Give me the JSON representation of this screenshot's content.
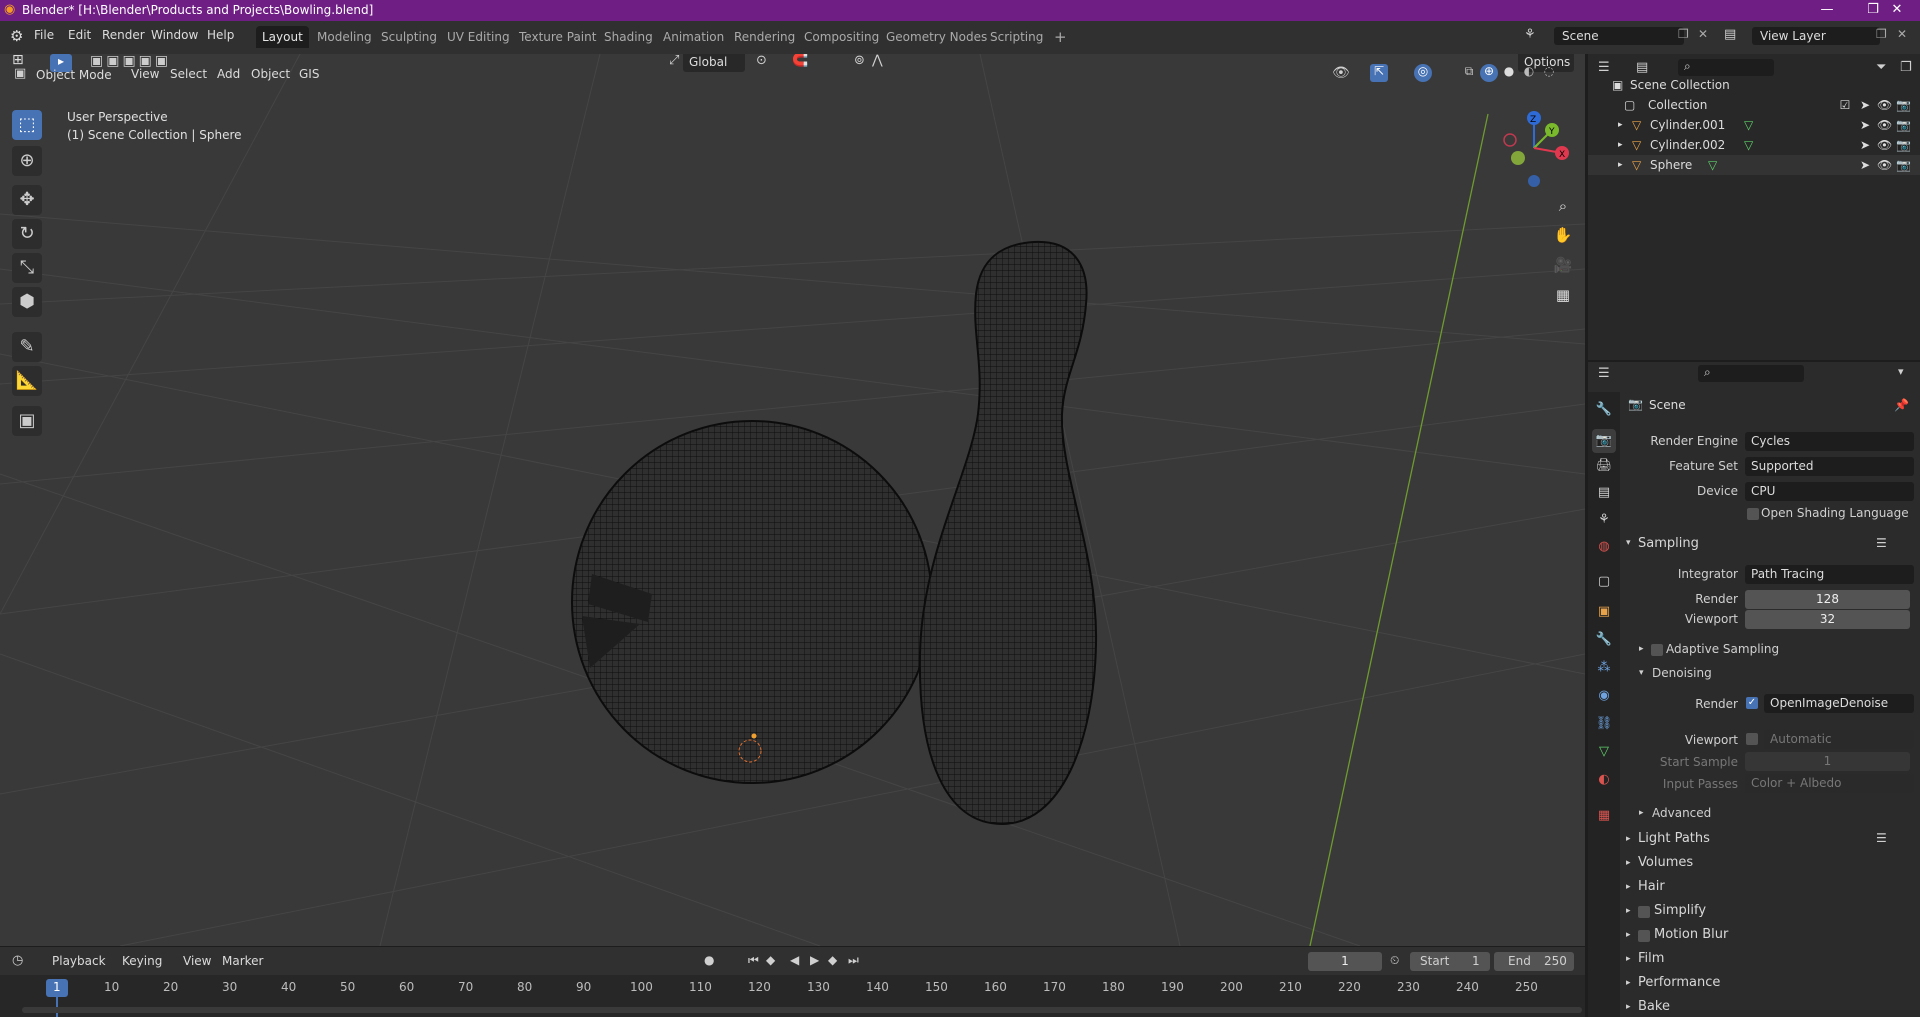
{
  "titlebar": {
    "title": "Blender* [H:\\Blender\\Products and Projects\\Bowling.blend]",
    "minimize": "—",
    "restore": "❐",
    "close": "✕"
  },
  "menu": {
    "file": "File",
    "edit": "Edit",
    "render": "Render",
    "window": "Window",
    "help": "Help"
  },
  "workspaces": [
    "Layout",
    "Modeling",
    "Sculpting",
    "UV Editing",
    "Texture Paint",
    "Shading",
    "Animation",
    "Rendering",
    "Compositing",
    "Geometry Nodes",
    "Scripting"
  ],
  "workspace_add": "+",
  "scene": {
    "name": "Scene",
    "view_layer": "View Layer"
  },
  "viewport": {
    "orientation": "Global",
    "options": "Options",
    "mode": "Object Mode",
    "menus": [
      "View",
      "Select",
      "Add",
      "Object",
      "GIS"
    ],
    "perspective": "User Perspective",
    "collection_info": "(1) Scene Collection | Sphere",
    "axis_labels": {
      "z": "Z",
      "y": "Y",
      "x": "X"
    }
  },
  "outliner": {
    "root": "Scene Collection",
    "items": [
      {
        "label": "Collection"
      },
      {
        "label": "Cylinder.001"
      },
      {
        "label": "Cylinder.002"
      },
      {
        "label": "Sphere"
      }
    ]
  },
  "properties": {
    "context": "Scene",
    "render_engine_label": "Render Engine",
    "render_engine": "Cycles",
    "feature_set_label": "Feature Set",
    "feature_set": "Supported",
    "device_label": "Device",
    "device": "CPU",
    "osl": "Open Shading Language",
    "sampling": "Sampling",
    "integrator_label": "Integrator",
    "integrator": "Path Tracing",
    "render_label": "Render",
    "render_samples": "128",
    "viewport_label": "Viewport",
    "viewport_samples": "32",
    "adaptive": "Adaptive Sampling",
    "denoising": "Denoising",
    "den_render_label": "Render",
    "denoiser": "OpenImageDenoise",
    "den_viewport_label": "Viewport",
    "den_viewport": "Automatic",
    "start_sample_label": "Start Sample",
    "start_sample": "1",
    "input_passes_label": "Input Passes",
    "input_passes": "Color + Albedo",
    "advanced": "Advanced",
    "panels": [
      "Light Paths",
      "Volumes",
      "Hair",
      "Simplify",
      "Motion Blur",
      "Film",
      "Performance",
      "Bake"
    ]
  },
  "timeline": {
    "menus": [
      "Playback",
      "Keying",
      "View",
      "Marker"
    ],
    "current_frame": "1",
    "start_label": "Start",
    "start": "1",
    "end_label": "End",
    "end": "250",
    "ticks": [
      "1",
      "10",
      "20",
      "30",
      "40",
      "50",
      "60",
      "70",
      "80",
      "90",
      "100",
      "110",
      "120",
      "130",
      "140",
      "150",
      "160",
      "170",
      "180",
      "190",
      "200",
      "210",
      "220",
      "230",
      "240",
      "250"
    ]
  }
}
